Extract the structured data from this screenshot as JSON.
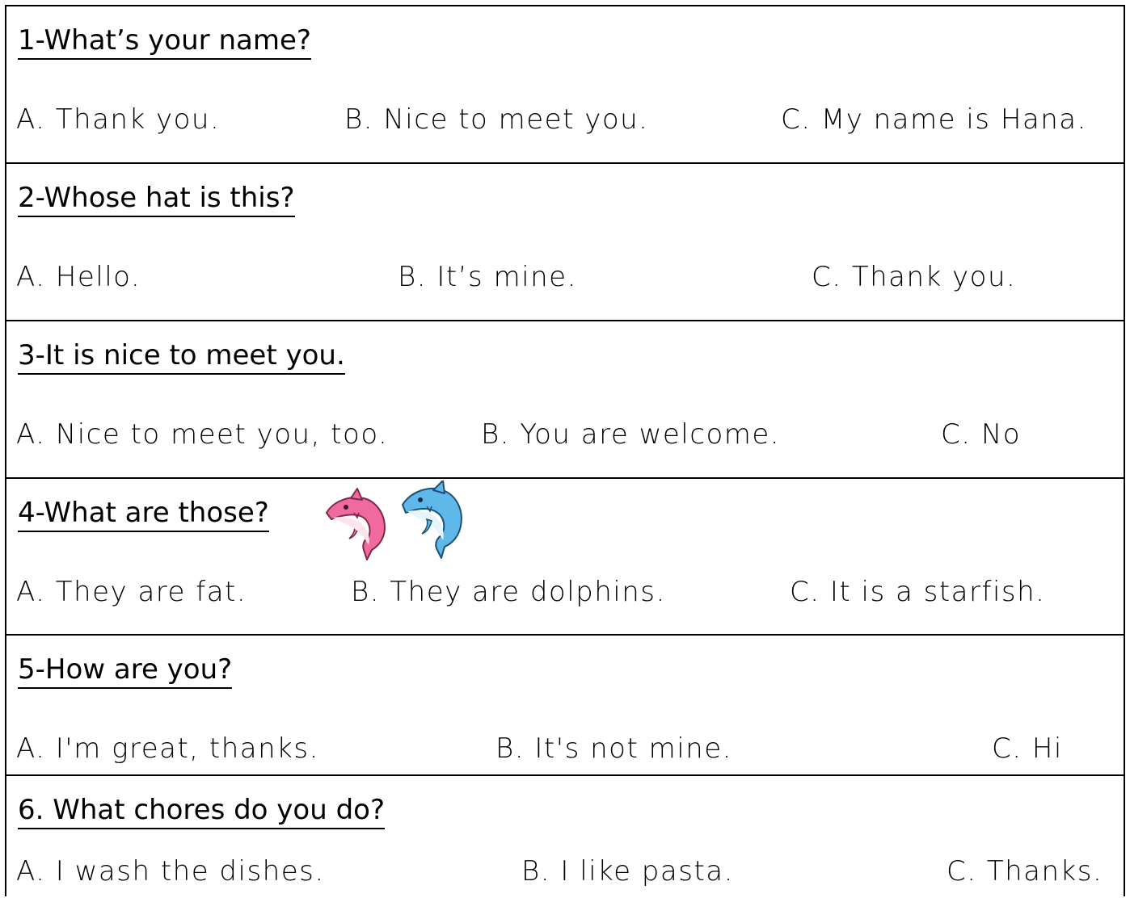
{
  "questions": [
    {
      "question": "1-What’s your name?",
      "options": [
        "A. Thank you.",
        "B. Nice to meet you.",
        "C. My name is Hana."
      ]
    },
    {
      "question": "2-Whose hat is this?",
      "options": [
        "A. Hello.",
        "B. It’s mine.",
        "C. Thank you."
      ]
    },
    {
      "question": "3-It is nice to meet you.",
      "options": [
        "A. Nice to meet you, too.",
        "B. You are welcome.",
        "C. No"
      ]
    },
    {
      "question": "4-What are those?",
      "options": [
        "A. They are fat.",
        "B. They are dolphins.",
        "C. It is a starfish."
      ],
      "image_icons": [
        "pink-dolphin-icon",
        "blue-dolphin-icon"
      ]
    },
    {
      "question": "5-How are you?",
      "options": [
        "A. I'm great, thanks.",
        "B. It's not mine.",
        "C. Hi"
      ]
    },
    {
      "question": "6. What chores do you do?",
      "options": [
        "A. I wash the dishes.",
        "B. I like pasta.",
        "C. Thanks."
      ]
    }
  ],
  "colors": {
    "pink_dolphin": "#f06aa0",
    "blue_dolphin": "#5fb8ea"
  }
}
